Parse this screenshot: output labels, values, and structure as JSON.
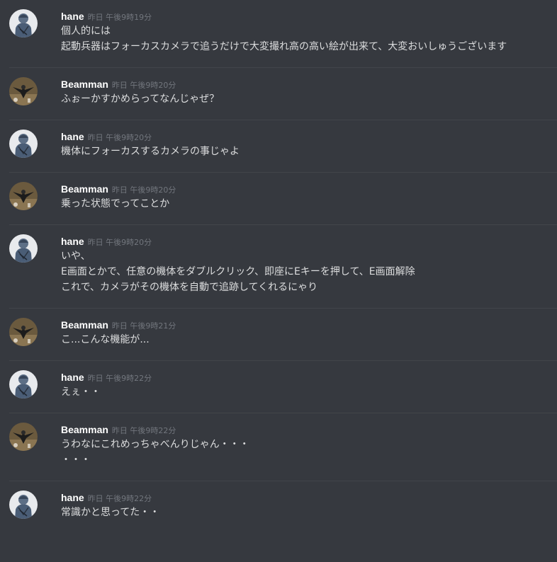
{
  "messages": [
    {
      "user": "hane",
      "avatar_icon": "hane-avatar-icon",
      "time": "昨日 午後9時19分",
      "lines": [
        "個人的には",
        "起動兵器はフォーカスカメラで追うだけで大変撮れ高の高い絵が出来て、大変おいしゅうございます"
      ]
    },
    {
      "user": "Beamman",
      "avatar_icon": "beamman-avatar-icon",
      "time": "昨日 午後9時20分",
      "lines": [
        "ふぉーかすかめらってなんじゃぜ？"
      ]
    },
    {
      "user": "hane",
      "avatar_icon": "hane-avatar-icon",
      "time": "昨日 午後9時20分",
      "lines": [
        "機体にフォーカスするカメラの事じゃよ"
      ]
    },
    {
      "user": "Beamman",
      "avatar_icon": "beamman-avatar-icon",
      "time": "昨日 午後9時20分",
      "lines": [
        "乗った状態でってことか"
      ]
    },
    {
      "user": "hane",
      "avatar_icon": "hane-avatar-icon",
      "time": "昨日 午後9時20分",
      "lines": [
        "いや、",
        "E画面とかで、任意の機体をダブルクリック、即座にEキーを押して、E画面解除",
        "これで、カメラがその機体を自動で追跡してくれるにゃり"
      ]
    },
    {
      "user": "Beamman",
      "avatar_icon": "beamman-avatar-icon",
      "time": "昨日 午後9時21分",
      "lines": [
        "こ...こんな機能が..."
      ]
    },
    {
      "user": "hane",
      "avatar_icon": "hane-avatar-icon",
      "time": "昨日 午後9時22分",
      "lines": [
        "えぇ・・"
      ]
    },
    {
      "user": "Beamman",
      "avatar_icon": "beamman-avatar-icon",
      "time": "昨日 午後9時22分",
      "lines": [
        "うわなにこれめっちゃべんりじゃん・・・",
        "・・・"
      ]
    },
    {
      "user": "hane",
      "avatar_icon": "hane-avatar-icon",
      "time": "昨日 午後9時22分",
      "lines": [
        "常識かと思ってた・・"
      ]
    }
  ],
  "colors": {
    "background": "#36393f",
    "divider": "#42454a",
    "username": "#ffffff",
    "timestamp": "#72767d",
    "message_text": "#dcddde"
  }
}
